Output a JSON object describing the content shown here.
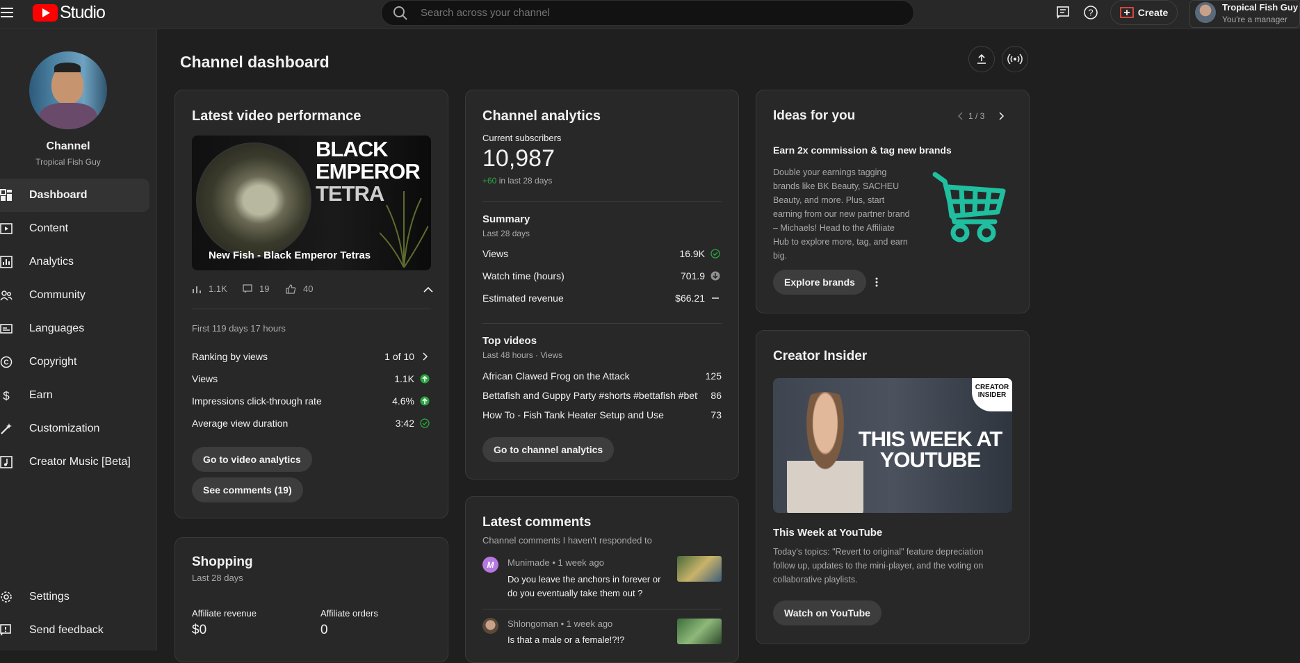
{
  "header": {
    "logo_text": "Studio",
    "search_placeholder": "Search across your channel",
    "create_label": "Create",
    "account_name": "Tropical Fish Guy",
    "account_role": "You're a manager"
  },
  "sidebar": {
    "channel_label": "Channel",
    "channel_name": "Tropical Fish Guy",
    "items": [
      {
        "label": "Dashboard",
        "icon": "dashboard-icon"
      },
      {
        "label": "Content",
        "icon": "content-icon"
      },
      {
        "label": "Analytics",
        "icon": "analytics-icon"
      },
      {
        "label": "Community",
        "icon": "community-icon"
      },
      {
        "label": "Languages",
        "icon": "languages-icon"
      },
      {
        "label": "Copyright",
        "icon": "copyright-icon"
      },
      {
        "label": "Earn",
        "icon": "earn-icon"
      },
      {
        "label": "Customization",
        "icon": "customization-icon"
      },
      {
        "label": "Creator Music [Beta]",
        "icon": "music-icon"
      }
    ],
    "settings_label": "Settings",
    "feedback_label": "Send feedback"
  },
  "page": {
    "title": "Channel dashboard"
  },
  "latest_video": {
    "title": "Latest video performance",
    "thumb_line1": "BLACK",
    "thumb_line2": "EMPEROR",
    "thumb_line3": "TETRA",
    "video_title": "New Fish - Black Emperor Tetras",
    "views_stat": "1.1K",
    "comments_stat": "19",
    "likes_stat": "40",
    "period": "First 119 days 17 hours",
    "rows": [
      {
        "label": "Ranking by views",
        "value": "1 of 10"
      },
      {
        "label": "Views",
        "value": "1.1K"
      },
      {
        "label": "Impressions click-through rate",
        "value": "4.6%"
      },
      {
        "label": "Average view duration",
        "value": "3:42"
      }
    ],
    "go_analytics": "Go to video analytics",
    "see_comments": "See comments (19)"
  },
  "shopping": {
    "title": "Shopping",
    "subtitle": "Last 28 days",
    "revenue_label": "Affiliate revenue",
    "revenue_value": "$0",
    "orders_label": "Affiliate orders",
    "orders_value": "0"
  },
  "channel_analytics": {
    "title": "Channel analytics",
    "subs_label": "Current subscribers",
    "subs_value": "10,987",
    "subs_delta": "+60",
    "subs_delta_suffix": " in last 28 days",
    "summary_title": "Summary",
    "summary_sub": "Last 28 days",
    "summary_rows": [
      {
        "label": "Views",
        "value": "16.9K"
      },
      {
        "label": "Watch time (hours)",
        "value": "701.9"
      },
      {
        "label": "Estimated revenue",
        "value": "$66.21"
      }
    ],
    "top_title": "Top videos",
    "top_sub": "Last 48 hours · Views",
    "top_rows": [
      {
        "label": "African Clawed Frog on the Attack",
        "value": "125"
      },
      {
        "label": "Bettafish and Guppy Party #shorts #bettafish #betta ...",
        "value": "86"
      },
      {
        "label": "How To - Fish Tank Heater Setup and Use",
        "value": "73"
      }
    ],
    "go_label": "Go to channel analytics"
  },
  "latest_comments": {
    "title": "Latest comments",
    "subtitle": "Channel comments I haven't responded to",
    "comments": [
      {
        "author": "Munimade",
        "time": "1 week ago",
        "line1": "Do you leave the anchors in forever or",
        "line2": "do you eventually take them out ?"
      },
      {
        "author": "Shlongoman",
        "time": "1 week ago",
        "line1": "Is that a male or a female!?!?",
        "line2": ""
      }
    ]
  },
  "ideas": {
    "title": "Ideas for you",
    "pager": "1 / 3",
    "headline": "Earn 2x commission & tag new brands",
    "body_lines": [
      "Double your earnings tagging",
      "brands like BK Beauty, SACHEU",
      "Beauty, and more. Plus, start",
      "earning from our new partner brand",
      "– Michaels! Head to the Affiliate",
      "Hub to explore more, tag, and earn",
      "big."
    ],
    "button": "Explore brands"
  },
  "creator_insider": {
    "title": "Creator Insider",
    "badge_line1": "CREATOR",
    "badge_line2": "INSIDER",
    "thumb_line1": "THIS WEEK AT",
    "thumb_line2": "YOUTUBE",
    "video_title": "This Week at YouTube",
    "body_lines": [
      "Today's topics: \"Revert to original\" feature depreciation",
      "follow up, updates to the mini-player, and the voting on",
      "collaborative playlists."
    ],
    "button": "Watch on YouTube"
  },
  "colors": {
    "brand_red": "#ff0000",
    "positive_green": "#2ba640",
    "cart_teal": "#1fbf9f"
  }
}
